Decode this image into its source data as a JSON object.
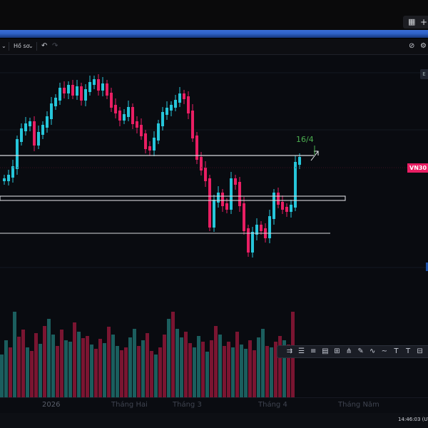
{
  "titlebar": {
    "grid_icon": "grid-icon",
    "plus_label": "+"
  },
  "toolbar": {
    "dropdown_caret": "⌄",
    "profile_label": "Hồ sơ",
    "profile_caret": "⌄",
    "undo": "↶",
    "redo": "↷",
    "right_icon_1": "⊘",
    "right_icon_2": "⚙"
  },
  "chart": {
    "symbol_tag": "VN30",
    "annotation": "16/4",
    "right_button": "E",
    "colors": {
      "up": "#26c6da",
      "down": "#e91e63",
      "annotation": "#4caf50",
      "price_tag": "#e91e63",
      "vol_up": "#1b5e5e",
      "vol_down": "#7a1531"
    }
  },
  "time_axis": {
    "labels": [
      "2026",
      "Tháng Hai",
      "Tháng 3",
      "Tháng 4",
      "Tháng Năm"
    ]
  },
  "drawing_toolbar": {
    "tools": [
      "⇉",
      "☰",
      "≡",
      "▤",
      "⊞",
      "⋔",
      "✎",
      "∿",
      "∼",
      "T",
      "T",
      "⊟"
    ]
  },
  "status": {
    "clock": "14:46:03 (UTC"
  }
}
